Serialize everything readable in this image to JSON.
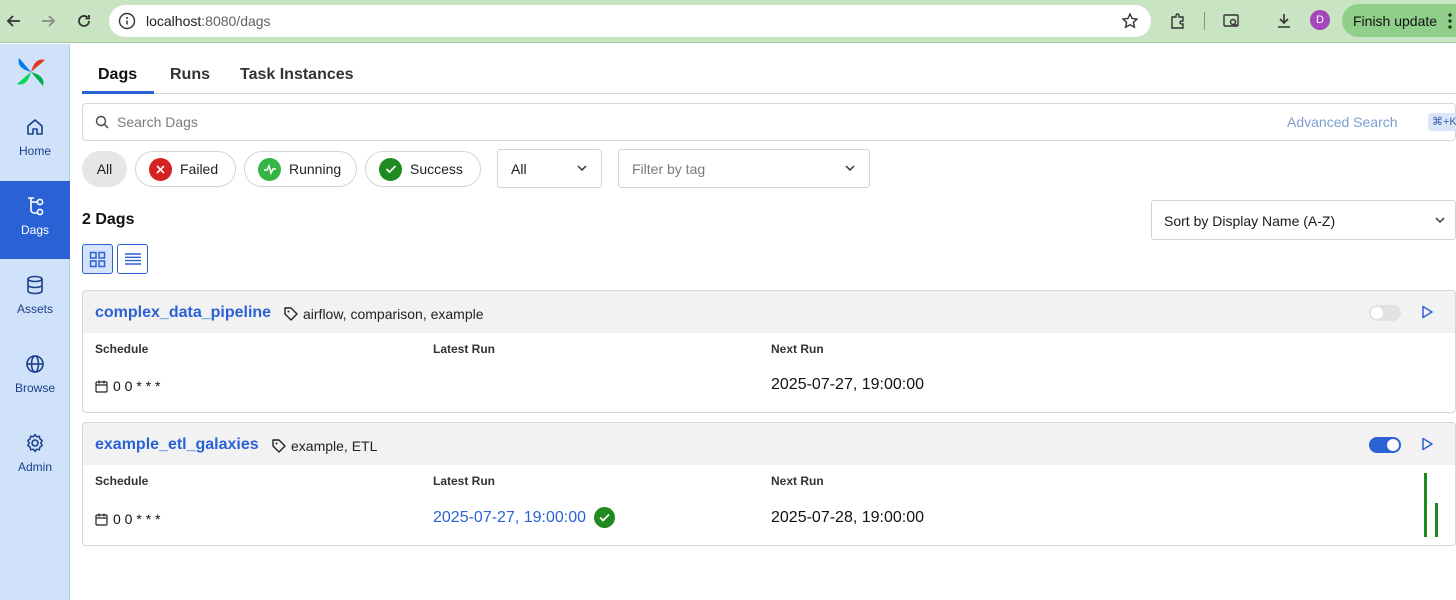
{
  "browser": {
    "url_host": "localhost",
    "url_rest": ":8080/dags",
    "profile_initial": "D",
    "finish_update": "Finish update"
  },
  "sidebar": {
    "items": [
      {
        "label": "Home",
        "icon": "home-icon"
      },
      {
        "label": "Dags",
        "icon": "dags-icon"
      },
      {
        "label": "Assets",
        "icon": "database-icon"
      },
      {
        "label": "Browse",
        "icon": "globe-icon"
      },
      {
        "label": "Admin",
        "icon": "gear-icon"
      }
    ],
    "active": "Dags"
  },
  "tabs": [
    {
      "label": "Dags"
    },
    {
      "label": "Runs"
    },
    {
      "label": "Task Instances"
    }
  ],
  "search": {
    "placeholder": "Search Dags",
    "advanced": "Advanced Search",
    "shortcut": "⌘+K"
  },
  "filters": {
    "state_pills": [
      "All",
      "Failed",
      "Running",
      "Success"
    ],
    "paused_select": "All",
    "tag_placeholder": "Filter by tag"
  },
  "summary": {
    "count": "2 Dags",
    "sort": "Sort by Display Name (A-Z)"
  },
  "columns": {
    "schedule": "Schedule",
    "latest_run": "Latest Run",
    "next_run": "Next Run"
  },
  "dags": [
    {
      "name": "complex_data_pipeline",
      "tags": "airflow, comparison, example",
      "schedule": "0 0 * * *",
      "latest_run": "",
      "next_run": "2025-07-27, 19:00:00",
      "enabled": false
    },
    {
      "name": "example_etl_galaxies",
      "tags": "example, ETL",
      "schedule": "0 0 * * *",
      "latest_run": "2025-07-27, 19:00:00",
      "latest_run_state": "success",
      "next_run": "2025-07-28, 19:00:00",
      "enabled": true
    }
  ],
  "colors": {
    "accent": "#2a62d6",
    "sidebar_bg": "#cfe2fa",
    "failed": "#d62222",
    "running": "#35b544",
    "success": "#1f8a1f",
    "chrome_bg": "#c9e4c3"
  }
}
